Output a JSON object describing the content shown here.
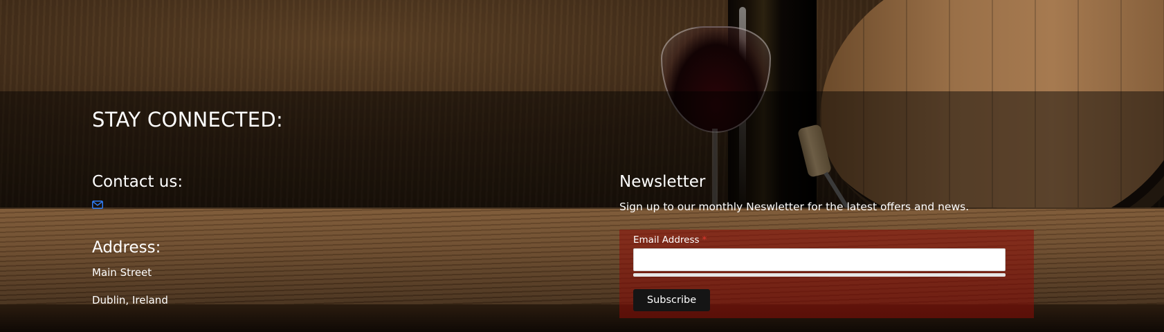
{
  "section": {
    "title": "STAY CONNECTED:"
  },
  "contact": {
    "heading": "Contact us:",
    "icon": "envelope-icon",
    "icon_color": "#2f7df6"
  },
  "address": {
    "heading": "Address:",
    "lines": [
      "Main Street",
      "Dublin, Ireland"
    ]
  },
  "newsletter": {
    "heading": "Newsletter",
    "description": "Sign up to our monthly Neswletter for the latest offers and news.",
    "form": {
      "email_label": "Email Address",
      "required_marker": "*",
      "email_value": "",
      "submit_label": "Subscribe"
    },
    "form_background": "#8c0c08"
  }
}
